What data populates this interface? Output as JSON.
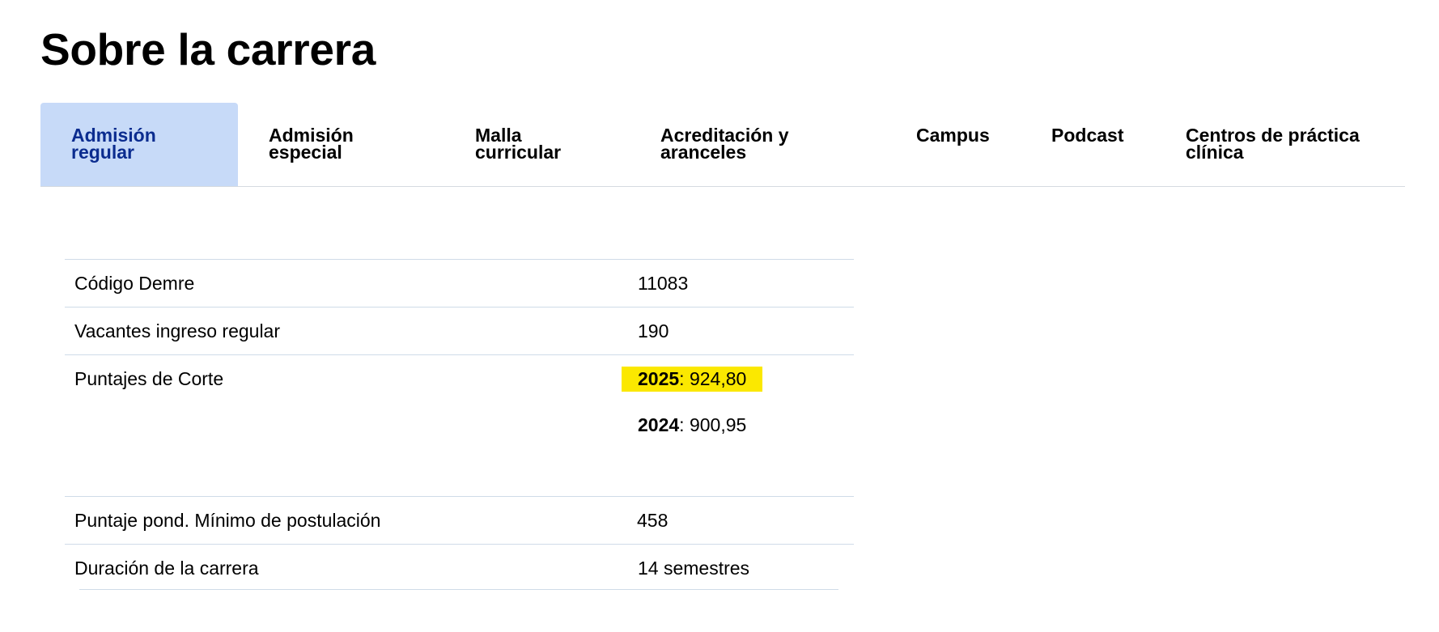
{
  "page": {
    "title": "Sobre la carrera"
  },
  "tabs": [
    {
      "line1": "Admisión",
      "line2": "regular",
      "active": true
    },
    {
      "line1": "Admisión",
      "line2": "especial",
      "active": false
    },
    {
      "line1": "Malla",
      "line2": "curricular",
      "active": false
    },
    {
      "line1": "Acreditación y",
      "line2": "aranceles",
      "active": false
    },
    {
      "line1": "Campus",
      "line2": "",
      "active": false
    },
    {
      "line1": "Podcast",
      "line2": "",
      "active": false
    },
    {
      "line1": "Centros de práctica",
      "line2": "clínica",
      "active": false
    }
  ],
  "table": {
    "codigo": {
      "label": "Código Demre",
      "value": "11083"
    },
    "vacantes": {
      "label": "Vacantes ingreso regular",
      "value": "190"
    },
    "puntajes": {
      "label": "Puntajes de Corte",
      "scores": [
        {
          "year": "2025",
          "value": ": 924,80",
          "highlighted": true
        },
        {
          "year": "2024",
          "value": ": 900,95",
          "highlighted": false
        }
      ]
    },
    "puntaje_minimo": {
      "label": "Puntaje pond. Mínimo de postulación",
      "value": "458"
    },
    "duracion": {
      "label": "Duración de la carrera",
      "value": "14 semestres"
    }
  },
  "colors": {
    "active_tab_bg": "#c7daf8",
    "active_tab_text": "#0b2c8f",
    "highlight": "#fbe800",
    "row_border": "#cfdbe8"
  }
}
